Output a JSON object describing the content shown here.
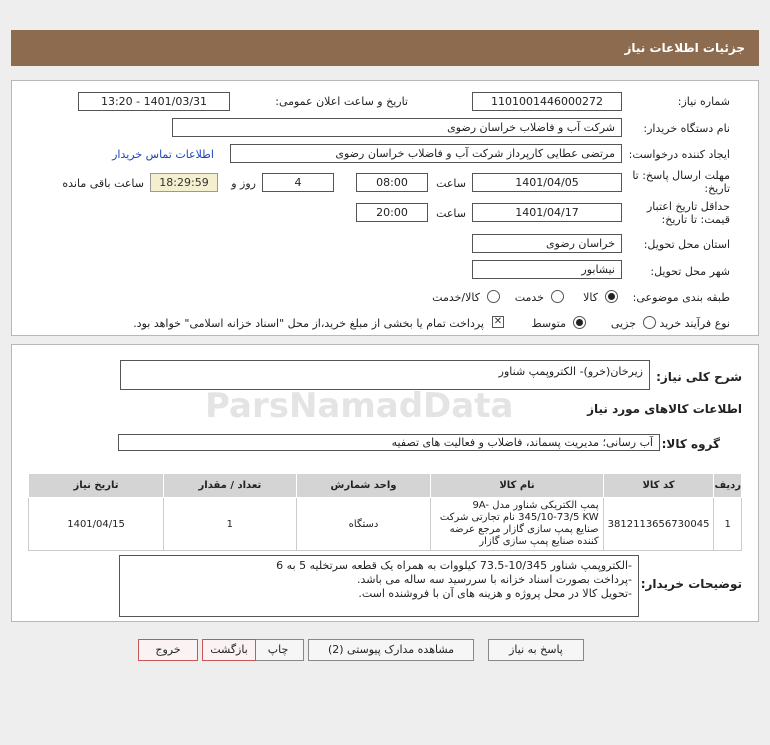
{
  "header": {
    "title": "جزئیات اطلاعات نیاز"
  },
  "fields": {
    "need_number_label": "شماره نیاز:",
    "need_number": "1101001446000272",
    "announce_label": "تاریخ و ساعت اعلان عمومی:",
    "announce_value": "1401/03/31 - 13:20",
    "buyer_org_label": "نام دستگاه خریدار:",
    "buyer_org": "شرکت آب و فاضلاب خراسان رضوی",
    "requester_label": "ایجاد کننده درخواست:",
    "requester": "مرتضی عطایی کارپرداز شرکت آب و فاضلاب خراسان رضوی",
    "buyer_contact_link": "اطلاعات تماس خریدار",
    "deadline_label_1": "مهلت ارسال پاسخ: تا",
    "deadline_label_2": "تاریخ:",
    "deadline_date": "1401/04/05",
    "time_label": "ساعت",
    "deadline_time": "08:00",
    "days_value": "4",
    "days_label": "روز و",
    "remaining_time": "18:29:59",
    "remaining_label": "ساعت باقی مانده",
    "validity_label_1": "حداقل تاریخ اعتبار",
    "validity_label_2": "قیمت: تا تاریخ:",
    "validity_date": "1401/04/17",
    "validity_time": "20:00",
    "province_label": "استان محل تحویل:",
    "province": "خراسان رضوی",
    "city_label": "شهر محل تحویل:",
    "city": "نیشابور",
    "category_label": "طبقه بندی موضوعی:",
    "category_options": [
      "کالا",
      "خدمت",
      "کالا/خدمت"
    ],
    "process_label": "نوع فرآیند خرید :",
    "process_options": [
      "جزیی",
      "متوسط"
    ],
    "payment_note": "پرداخت تمام یا بخشی از مبلغ خرید،از محل \"اسناد خزانه اسلامی\" خواهد بود."
  },
  "summary": {
    "label": "شرح کلی نیاز:",
    "value": "زیرخان(خرو)- الکتروپمپ شناور",
    "goods_info_title": "اطلاعات کالاهای مورد نیاز",
    "group_label": "گروه کالا:",
    "group_value": "آب رسانی؛ مدیریت پسماند، فاضلاب و فعالیت های تصفیه"
  },
  "table": {
    "headers": [
      "ردیف",
      "کد کالا",
      "نام کالا",
      "واحد شمارش",
      "تعداد / مقدار",
      "تاریخ نیاز"
    ],
    "rows": [
      {
        "index": "1",
        "code": "3812113656730045",
        "name": "پمپ الکتریکی شناور مدل 9A-345/10-73/5 KW نام تجارتی شرکت صنایع پمپ سازی گازار مرجع عرضه کننده صنایع پمپ سازی گازار",
        "unit": "دستگاه",
        "qty": "1",
        "date": "1401/04/15"
      }
    ]
  },
  "notes": {
    "label": "توضیحات خریدار:",
    "lines": [
      "-الکتروپمپ شناور 10/345-73.5 کیلووات به همراه یک قطعه سرتخلیه 5 به 6",
      "-پرداخت بصورت اسناد خزانه با سررسید سه ساله می باشد.",
      "-تحویل کالا در محل پروژه و هزینه های آن با فروشنده است."
    ]
  },
  "buttons": {
    "reply": "پاسخ به نیاز",
    "docs": "مشاهده مدارک پیوستی (2)",
    "print": "چاپ",
    "back": "بازگشت",
    "exit": "خروج"
  },
  "watermark": {
    "brand": "ParsNamadData"
  }
}
